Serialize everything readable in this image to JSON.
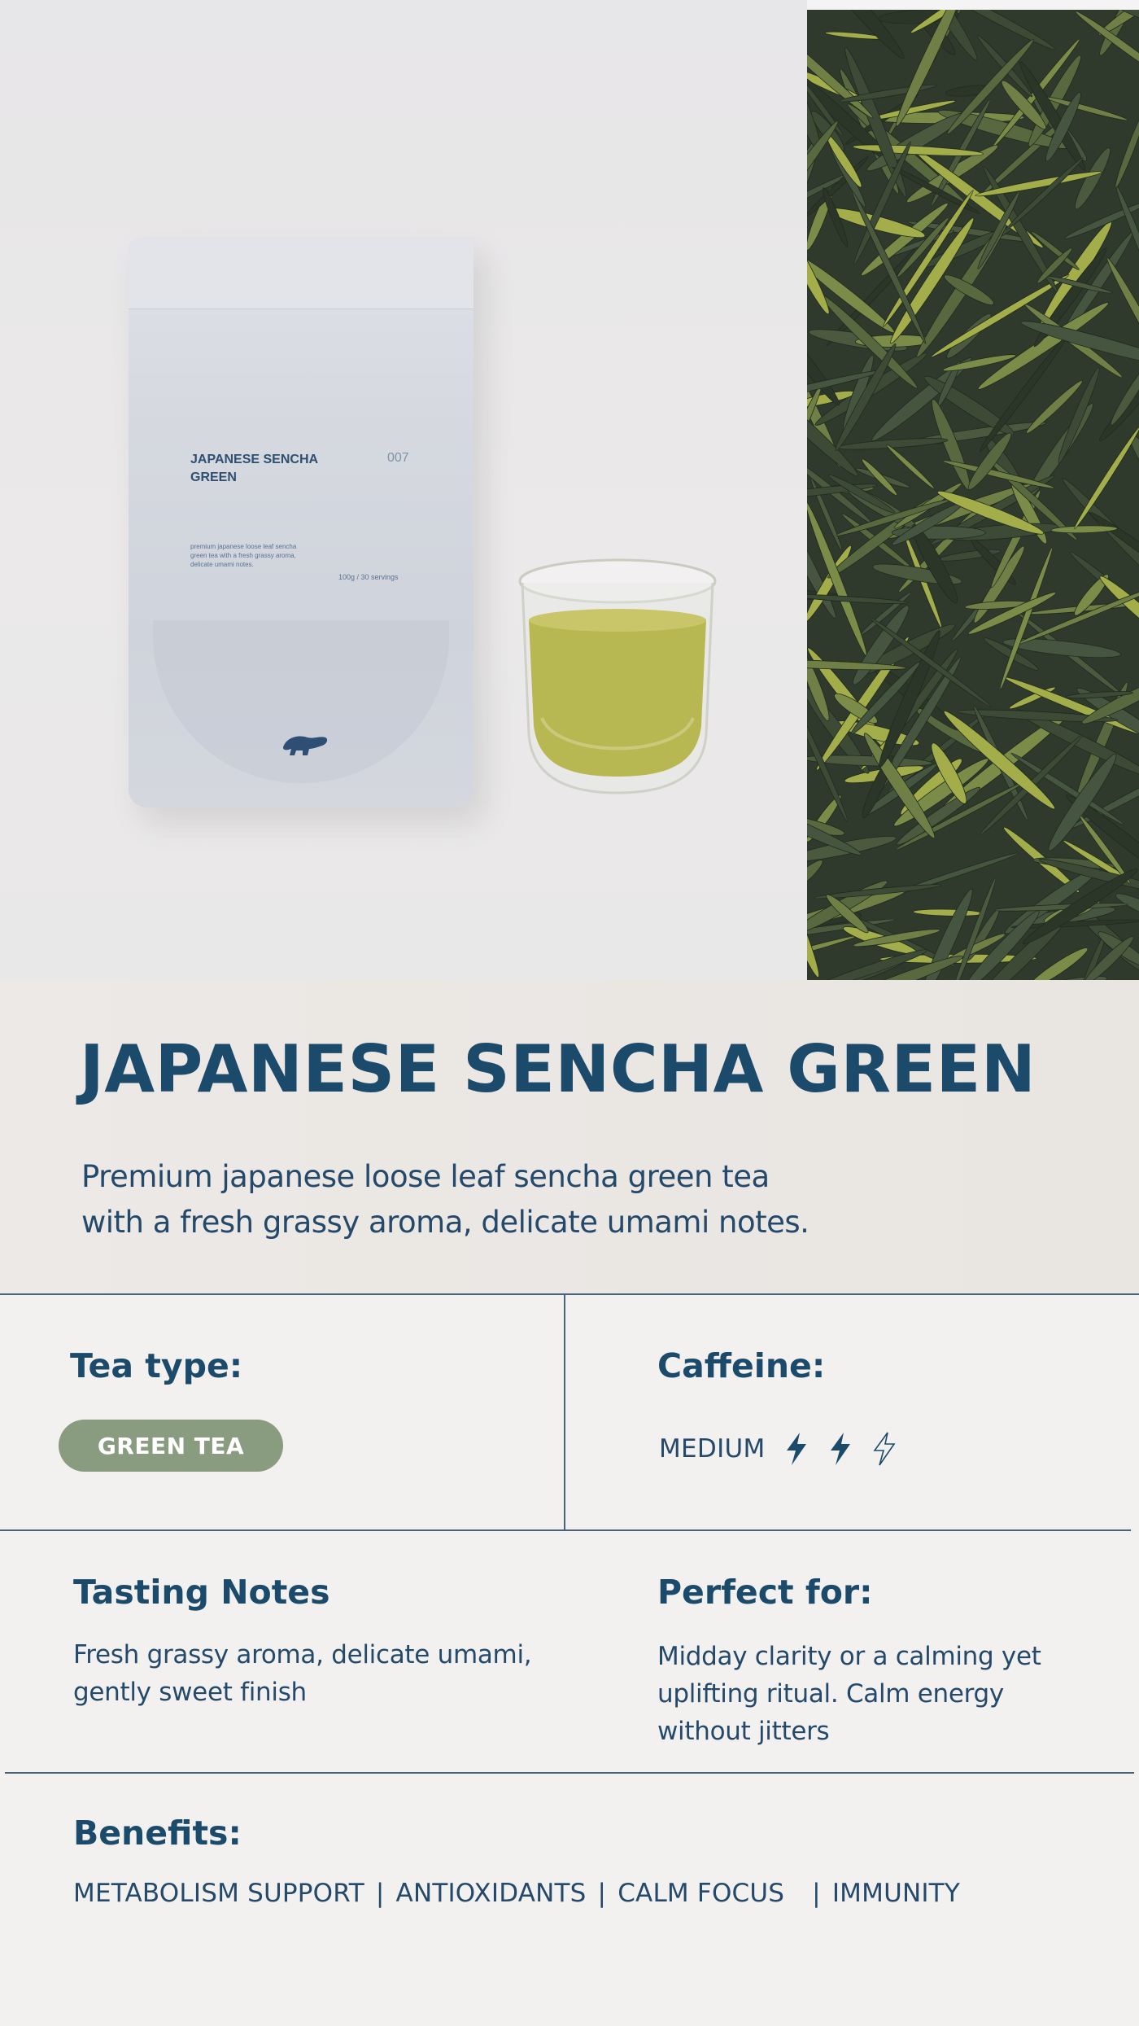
{
  "hero": {
    "pouch_name": "JAPANESE SENCHA GREEN",
    "pouch_number": "007",
    "pouch_description": "premium japanese loose leaf sencha green tea with a fresh grassy aroma, delicate umami notes.",
    "pouch_weight": "100g / 30 servings"
  },
  "product": {
    "title": "JAPANESE SENCHA GREEN",
    "description_line1": "Premium japanese loose leaf sencha green tea",
    "description_line2": "with a fresh grassy aroma, delicate umami notes."
  },
  "tea_type": {
    "heading": "Tea type:",
    "badge": "GREEN TEA",
    "badge_color": "#8a9c80"
  },
  "caffeine": {
    "heading": "Caffeine:",
    "level_label": "MEDIUM",
    "level": 2,
    "max_level": 3,
    "icon": "lightning-bolt-icon"
  },
  "tasting_notes": {
    "heading": "Tasting Notes",
    "line1": "Fresh grassy aroma, delicate umami,",
    "line2": "gently sweet finish"
  },
  "perfect_for": {
    "heading": "Perfect for:",
    "line1": "Midday clarity or a calming yet",
    "line2": "uplifting ritual. Calm energy",
    "line3": "without jitters"
  },
  "benefits": {
    "heading": "Benefits:",
    "items": [
      "METABOLISM SUPPORT",
      "ANTIOXIDANTS",
      "CALM FOCUS",
      "IMMUNITY"
    ]
  },
  "colors": {
    "primary": "#1b4a6b",
    "title_band": "#ebe7e3",
    "page_background": "#f2f1ef",
    "divider": "#47627b"
  }
}
